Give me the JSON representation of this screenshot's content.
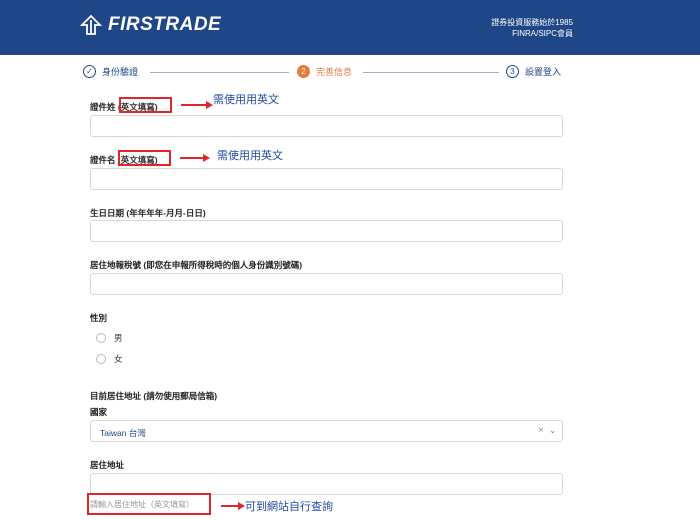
{
  "header": {
    "brand": "FIRSTRADE",
    "tagline_line1": "證券投資服務始於1985",
    "tagline_line2": "FINRA/SIPC會員"
  },
  "steps": [
    {
      "icon": "✓",
      "label": "身份驗證",
      "state": "done"
    },
    {
      "icon": "2",
      "label": "完善信息",
      "state": "active"
    },
    {
      "icon": "3",
      "label": "設置登入",
      "state": "pending"
    }
  ],
  "form": {
    "surname_label": "證件姓",
    "surname_note": "(英文填寫)",
    "surname_value": "",
    "given_label": "證件名",
    "given_note": "(英文填寫)",
    "given_value": "",
    "dob_label": "生日日期 (年年年年-月月-日日)",
    "dob_value": "",
    "tax_label": "居住地報稅號 (即您在申報所得稅時的個人身份識別號碼)",
    "tax_value": "",
    "gender_label": "性別",
    "gender_options": [
      "男",
      "女"
    ],
    "address_section_label": "目前居住地址 (請勿使用郵局信箱)",
    "country_label": "國家",
    "country_value": "Taiwan 台灣",
    "address_label": "居住地址",
    "address_value": "",
    "address_placeholder": "請輸入居住地址（英文填寫）"
  },
  "annotations": {
    "surname_hint": "需使用用英文",
    "given_hint": "需使用用英文",
    "address_hint": "可到網站自行查詢"
  },
  "colors": {
    "header_bg": "#1f4788",
    "active_step": "#e87a3c",
    "annotation_red": "#e0262a",
    "annotation_blue": "#1f4aa8"
  }
}
